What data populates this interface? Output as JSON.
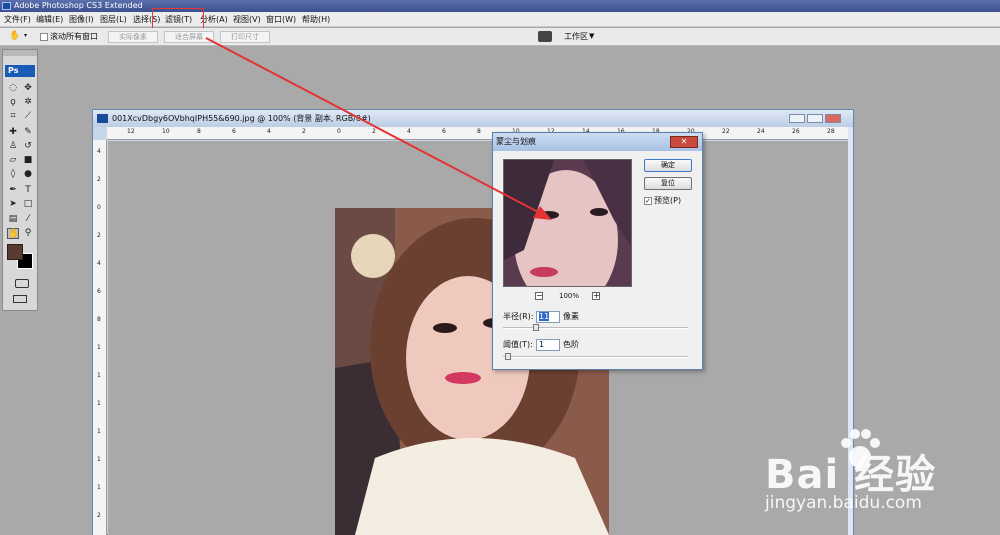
{
  "app": {
    "title": "Adobe Photoshop CS3 Extended"
  },
  "menubar": {
    "items": [
      "文件(F)",
      "编辑(E)",
      "图像(I)",
      "图层(L)",
      "选择(S)",
      "滤镜(T)",
      "分析(A)",
      "视图(V)",
      "窗口(W)",
      "帮助(H)"
    ]
  },
  "options_bar": {
    "scroll_all_windows": "滚动所有窗口",
    "actual_pixels": "实际像素",
    "fit_screen": "适合屏幕",
    "print_size": "打印尺寸",
    "workspace": "工作区"
  },
  "toolbox": {
    "logo": "Ps"
  },
  "document": {
    "title": "001XcvDbgy6OVbhqIPH55&690.jpg @ 100% (背景 副本, RGB/8#)",
    "h_ruler": [
      "12",
      "10",
      "8",
      "6",
      "4",
      "2",
      "0",
      "2",
      "4",
      "6",
      "8",
      "10",
      "12",
      "14",
      "16",
      "18",
      "20",
      "22",
      "24",
      "26",
      "28"
    ],
    "v_ruler": [
      "4",
      "2",
      "0",
      "2",
      "4",
      "6",
      "8",
      "1",
      "1",
      "1",
      "1",
      "1",
      "1",
      "2"
    ]
  },
  "dialog": {
    "title": "蒙尘与划痕",
    "ok": "确定",
    "reset": "复位",
    "preview_label": "预览(P)",
    "preview_checked": true,
    "zoom": "100%",
    "zoom_out": "−",
    "zoom_in": "+",
    "radius_label": "半径(R):",
    "radius_value": "11",
    "radius_unit": "像素",
    "threshold_label": "阈值(T):",
    "threshold_value": "1",
    "threshold_unit": "色阶"
  },
  "watermark": {
    "brand": "Bai  经验",
    "site": "jingyan.baidu.com"
  },
  "colors": {
    "annotation": "#e33333",
    "title_bar": "#3c4f8f",
    "foreground_swatch": "#5a3a32"
  }
}
